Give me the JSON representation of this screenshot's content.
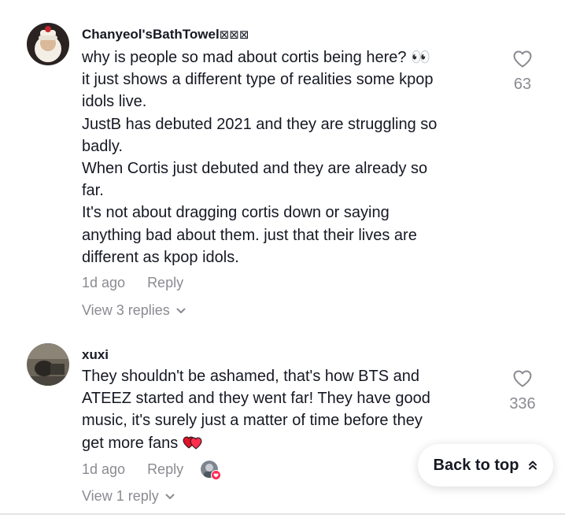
{
  "comments": [
    {
      "username": "Chanyeol'sBathTowel",
      "username_suffix": "⊠⊠⊠",
      "lines": [
        "why is people so mad about cortis being here? 👀",
        "it just shows a different type of realities some kpop",
        "idols live.",
        "JustB has debuted 2021 and they are struggling so",
        "badly.",
        "When Cortis just debuted and they are already so",
        "far.",
        "It's not about dragging cortis down or saying",
        "anything bad about them. just that their lives are",
        "different as kpop idols."
      ],
      "time": "1d ago",
      "reply_label": "Reply",
      "view_replies": "View 3 replies",
      "like_count": "63"
    },
    {
      "username": "xuxi",
      "lines": [
        "They shouldn't be ashamed, that's how BTS and",
        "ATEEZ started and they went far! They have good",
        "music, it's surely just a matter of time before they",
        "get more fans"
      ],
      "time": "1d ago",
      "reply_label": "Reply",
      "view_replies": "View 1 reply",
      "like_count": "336"
    }
  ],
  "back_to_top": "Back to top",
  "icons": {
    "like": "heart-outline-icon",
    "chevron": "chevron-down-icon",
    "back_to_top": "double-chevron-up-icon",
    "creator_liked": "heart-badge-icon"
  },
  "colors": {
    "text": "#161823",
    "muted": "#8a8b91",
    "heart_red": "#fe2c55"
  }
}
